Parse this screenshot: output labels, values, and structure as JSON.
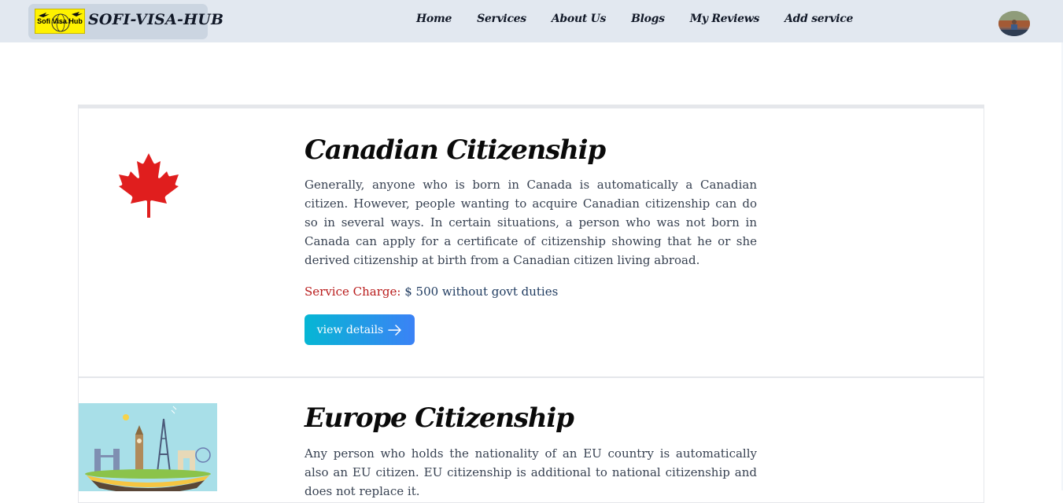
{
  "nav": {
    "logo_text": "Sofi Visa Hub",
    "brand": "SOFI-VISA-HUB",
    "links": [
      "Home",
      "Services",
      "About Us",
      "Blogs",
      "My Reviews",
      "Add service"
    ]
  },
  "services": [
    {
      "title": "Canadian Citizenship",
      "description": "Generally, anyone who is born in Canada is automatically a Canadian citizen. However, people wanting to acquire Canadian citizenship can do so in several ways. In certain situations, a person who was not born in Canada can apply for a certificate of citizenship showing that he or she derived citizenship at birth from a Canadian citizen living abroad.",
      "charge_label": "Service Charge:",
      "charge_value": "$ 500 without govt duties",
      "button_label": "view details",
      "image": "maple-leaf-flag"
    },
    {
      "title": "Europe Citizenship",
      "description": "Any person who holds the nationality of an EU country is automatically also an EU citizen. EU citizenship is additional to national citizenship and does not replace it.",
      "image": "europe-landmarks-illustration"
    }
  ],
  "colors": {
    "navbar_bg": "#e2e8f0",
    "brand_bg": "#cbd5e1",
    "charge_label": "#b91c1c",
    "button_gradient_start": "#06b6d4",
    "button_gradient_end": "#3b82f6"
  }
}
